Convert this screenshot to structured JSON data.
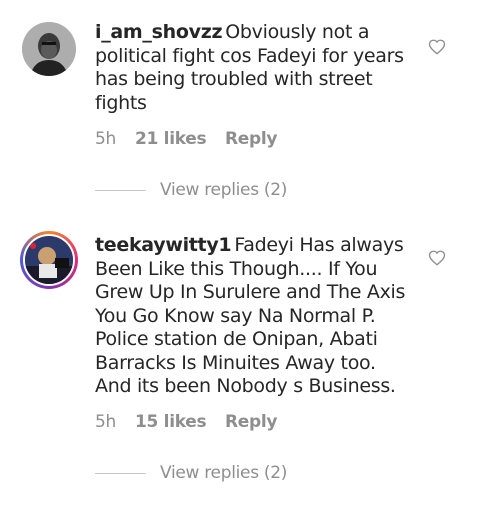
{
  "comments": [
    {
      "username": "i_am_shovzz",
      "text": "Obviously not a political fight cos Fadeyi for years has being troubled with street fights",
      "time": "5h",
      "likes": "21 likes",
      "reply_label": "Reply",
      "view_replies": "View replies (2)",
      "like_icon": "heart-outline-icon"
    },
    {
      "username": "teekaywitty1",
      "text": "Fadeyi Has always Been Like this Though.... If You Grew Up In Surulere and The Axis You Go Know say Na Normal P. Police station de Onipan, Abati Barracks Is Minuites Away too. And its been Nobody s Business.",
      "time": "5h",
      "likes": "15 likes",
      "reply_label": "Reply",
      "view_replies": "View replies (2)",
      "like_icon": "heart-outline-icon"
    }
  ]
}
